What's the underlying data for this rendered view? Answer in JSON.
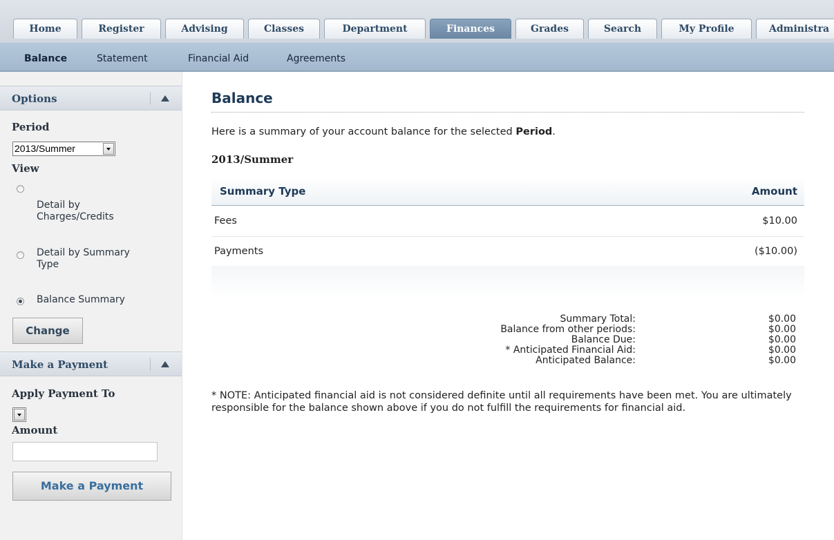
{
  "tabs": [
    "Home",
    "Register",
    "Advising",
    "Classes",
    "Department",
    "Finances",
    "Grades",
    "Search",
    "My Profile",
    "Administra"
  ],
  "active_tab": "Finances",
  "subnav": [
    "Balance",
    "Statement",
    "Financial Aid",
    "Agreements"
  ],
  "active_subnav": "Balance",
  "sidebar": {
    "options_title": "Options",
    "period_label": "Period",
    "period_value": "2013/Summer",
    "view_label": "View",
    "view_options": [
      {
        "label": "Detail by Charges/Credits",
        "checked": false
      },
      {
        "label": "Detail by Summary Type",
        "checked": false
      },
      {
        "label": "Balance Summary",
        "checked": true
      }
    ],
    "change_button": "Change",
    "payment_title": "Make a Payment",
    "apply_to_label": "Apply Payment To",
    "apply_to_value": "",
    "amount_label": "Amount",
    "amount_value": "",
    "payment_button": "Make a Payment"
  },
  "main": {
    "title": "Balance",
    "intro_before": "Here is a summary of your account balance for the selected ",
    "intro_bold": "Period",
    "intro_after": ".",
    "period_heading": "2013/Summer",
    "grid": {
      "headers": [
        "Summary Type",
        "Amount"
      ],
      "rows": [
        {
          "type": "Fees",
          "amount": "$10.00"
        },
        {
          "type": "Payments",
          "amount": "($10.00)"
        }
      ]
    },
    "totals": [
      {
        "label": "Summary Total:",
        "value": "$0.00"
      },
      {
        "label": "Balance from other periods:",
        "value": "$0.00"
      },
      {
        "label": "Balance Due:",
        "value": "$0.00"
      },
      {
        "label": "* Anticipated Financial Aid:",
        "value": "$0.00"
      },
      {
        "label": "Anticipated Balance:",
        "value": "$0.00"
      }
    ],
    "note": "* NOTE: Anticipated financial aid is not considered definite until all requirements have been met. You are ultimately responsible for the balance shown above if you do not fulfill the requirements for financial aid."
  },
  "colors": {
    "accent": "#1e3a57",
    "active_tab": "#7a96b2",
    "subnav": "#aec2d6",
    "sidebar": "#f1f1f1"
  }
}
